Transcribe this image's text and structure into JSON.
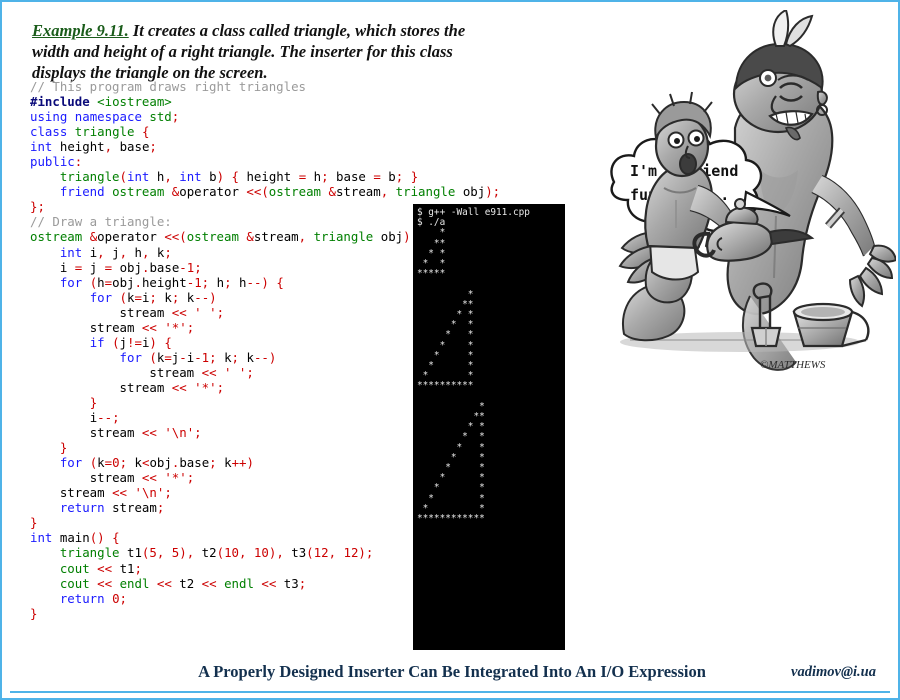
{
  "border_color": "#4fb3e8",
  "intro": {
    "example_label": "Example 9.11.",
    "text_part1": " It creates a class called ",
    "term": "triangle",
    "text_part2": ", which stores the width and height of a right triangle. The inserter for this class displays the triangle on the screen."
  },
  "code": {
    "language": "cpp",
    "lines": [
      "// This program draws right triangles",
      "#include <iostream>",
      "using namespace std;",
      "class triangle {",
      "int height, base;",
      "public:",
      "    triangle(int h, int b) { height = h; base = b; }",
      "    friend ostream &operator <<(ostream &stream, triangle obj);",
      "};",
      "// Draw a triangle:",
      "ostream &operator <<(ostream &stream, triangle obj) {",
      "    int i, j, h, k;",
      "    i = j = obj.base-1;",
      "    for (h=obj.height-1; h; h--) {",
      "        for (k=i; k; k--)",
      "            stream << ' ';",
      "        stream << '*';",
      "        if (j!=i) {",
      "            for (k=j-i-1; k; k--)",
      "                stream << ' ';",
      "            stream << '*';",
      "        }",
      "        i--;",
      "        stream << '\\n';",
      "    }",
      "    for (k=0; k<obj.base; k++)",
      "        stream << '*';",
      "    stream << '\\n';",
      "    return stream;",
      "}",
      "int main() {",
      "    triangle t1(5, 5), t2(10, 10), t3(12, 12);",
      "    cout << t1;",
      "    cout << endl << t2 << endl << t3;",
      "    return 0;",
      "}"
    ],
    "colors": {
      "comment": "#9a9a9a",
      "keyword": "#1a1aff",
      "preprocessor": "#0a0a7a",
      "type": "#007f00",
      "string": "#cc0000",
      "operator": "#cc0000",
      "identifier": "#000000"
    }
  },
  "terminal": {
    "background": "#000000",
    "foreground": "#e8e8e8",
    "commands": [
      "$ g++ -Wall e911.cpp",
      "$ ./a"
    ],
    "output_lines": [
      "    *",
      "   **",
      "  * *",
      " *  *",
      "*****",
      "",
      "         *",
      "        **",
      "       * *",
      "      *  *",
      "     *   *",
      "    *    *",
      "   *     *",
      "  *      *",
      " *       *",
      "**********",
      "",
      "           *",
      "          **",
      "         * *",
      "        *  *",
      "       *   *",
      "      *    *",
      "     *     *",
      "    *      *",
      "   *       *",
      "  *        *",
      " *         *",
      "************"
    ]
  },
  "cartoon": {
    "speech_bubble_line1": "I'm a Friend",
    "speech_bubble_line2": "function...",
    "signature": "MATTHEWS",
    "description": "genie-emerging-from-lamp-with-kneeling-man"
  },
  "caption": {
    "text": "A Properly Designed Inserter Can Be Integrated Into An I/O Expression",
    "email": "vadimov@i.ua"
  }
}
